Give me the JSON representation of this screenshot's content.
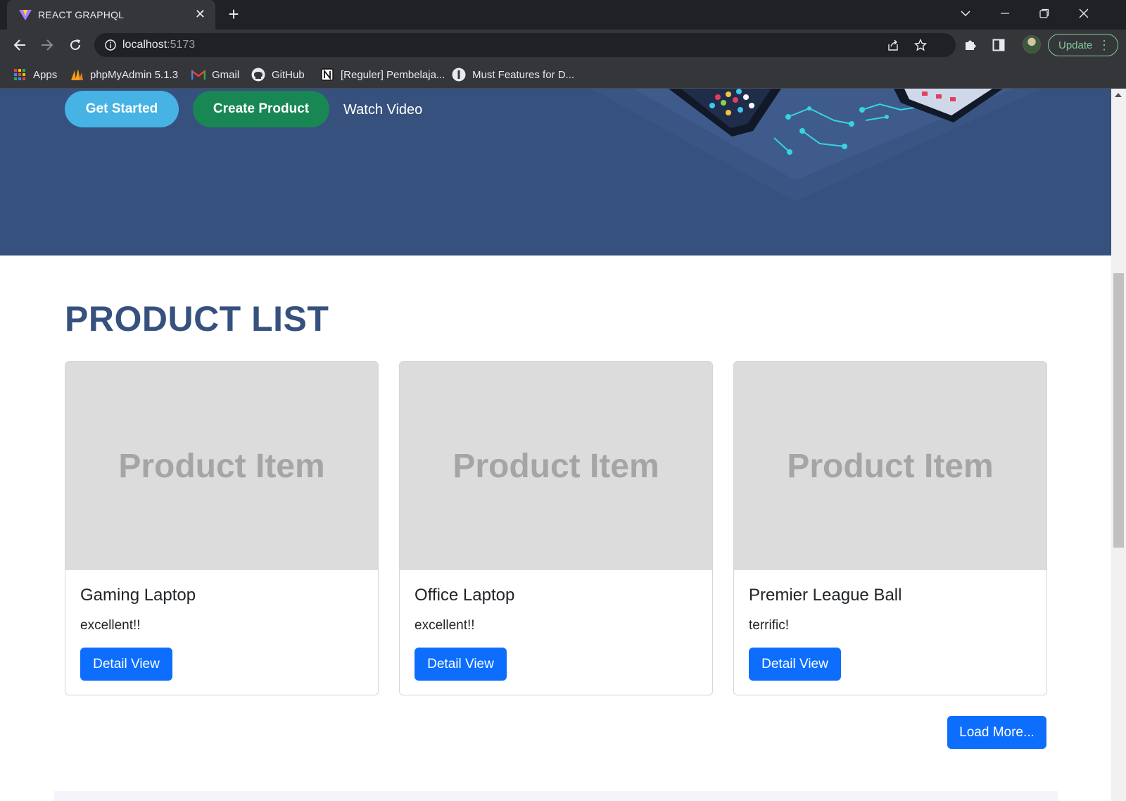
{
  "browser": {
    "tab_title": "REACT GRAPHQL",
    "tab_close": "✕",
    "new_tab": "+",
    "url_host": "localhost",
    "url_port": ":5173",
    "update_label": "Update",
    "bookmarks": [
      {
        "label": "Apps",
        "icon": "apps-grid-icon"
      },
      {
        "label": "phpMyAdmin 5.1.3",
        "icon": "phpmyadmin-icon"
      },
      {
        "label": "Gmail",
        "icon": "gmail-icon"
      },
      {
        "label": "GitHub",
        "icon": "github-icon"
      },
      {
        "label": "[Reguler] Pembelaja...",
        "icon": "notion-icon"
      },
      {
        "label": "Must Features for D...",
        "icon": "page-icon"
      }
    ]
  },
  "hero": {
    "get_started": "Get Started",
    "create_product": "Create Product",
    "watch_video": "Watch Video"
  },
  "products": {
    "section_title": "PRODUCT LIST",
    "placeholder_text": "Product Item",
    "detail_label": "Detail View",
    "items": [
      {
        "name": "Gaming Laptop",
        "description": "excellent!!"
      },
      {
        "name": "Office Laptop",
        "description": "excellent!!"
      },
      {
        "name": "Premier League Ball",
        "description": "terrific!"
      }
    ],
    "load_more": "Load More..."
  },
  "colors": {
    "hero_bg": "#37517e",
    "get_started": "#47b2e4",
    "create_product": "#198754",
    "primary": "#0d6efd"
  }
}
